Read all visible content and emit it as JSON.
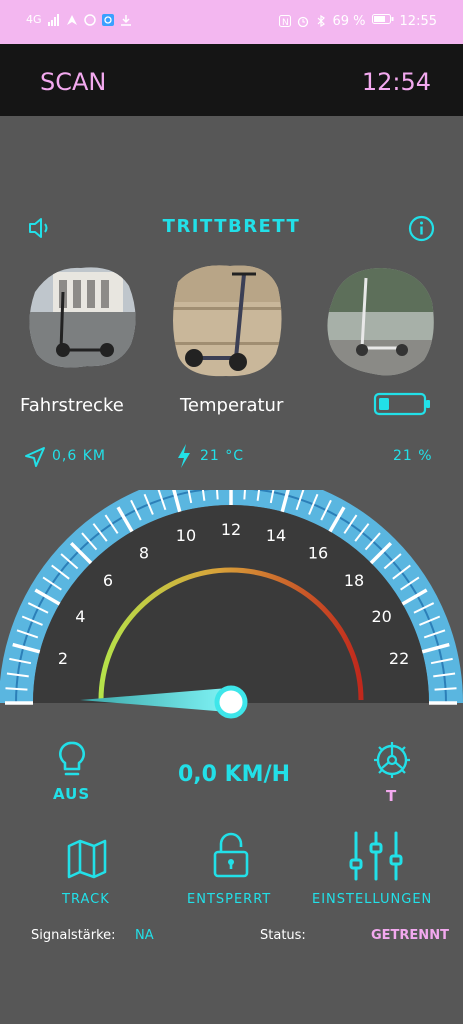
{
  "status_bar": {
    "network": "4G",
    "battery": "69 %",
    "time": "12:55"
  },
  "header": {
    "scan_label": "SCAN",
    "time": "12:54"
  },
  "section": {
    "title": "TRITTBRETT"
  },
  "cards": [
    {
      "label": "Fahrstrecke",
      "value": "0,6 KM"
    },
    {
      "label": "Temperatur",
      "value": "21 °C"
    },
    {
      "label": "",
      "value": "21 %"
    }
  ],
  "gauge": {
    "tick_labels": [
      "2",
      "4",
      "6",
      "8",
      "10",
      "12",
      "14",
      "16",
      "18",
      "20",
      "22"
    ],
    "needle_value": 0
  },
  "speed": {
    "text": "0,0  KM/H"
  },
  "controls": {
    "light_label": "AUS",
    "mode_label": "T"
  },
  "nav": {
    "track": "TRACK",
    "lock": "ENTSPERRT",
    "settings": "EINSTELLUNGEN"
  },
  "footer": {
    "signal_label": "Signalstärke:",
    "signal_value": "NA",
    "status_label": "Status:",
    "status_value": "GETRENNT"
  },
  "colors": {
    "accent": "#22e0e8",
    "pink": "#f3a9ef",
    "topbar": "#151515",
    "bg": "#575757"
  }
}
